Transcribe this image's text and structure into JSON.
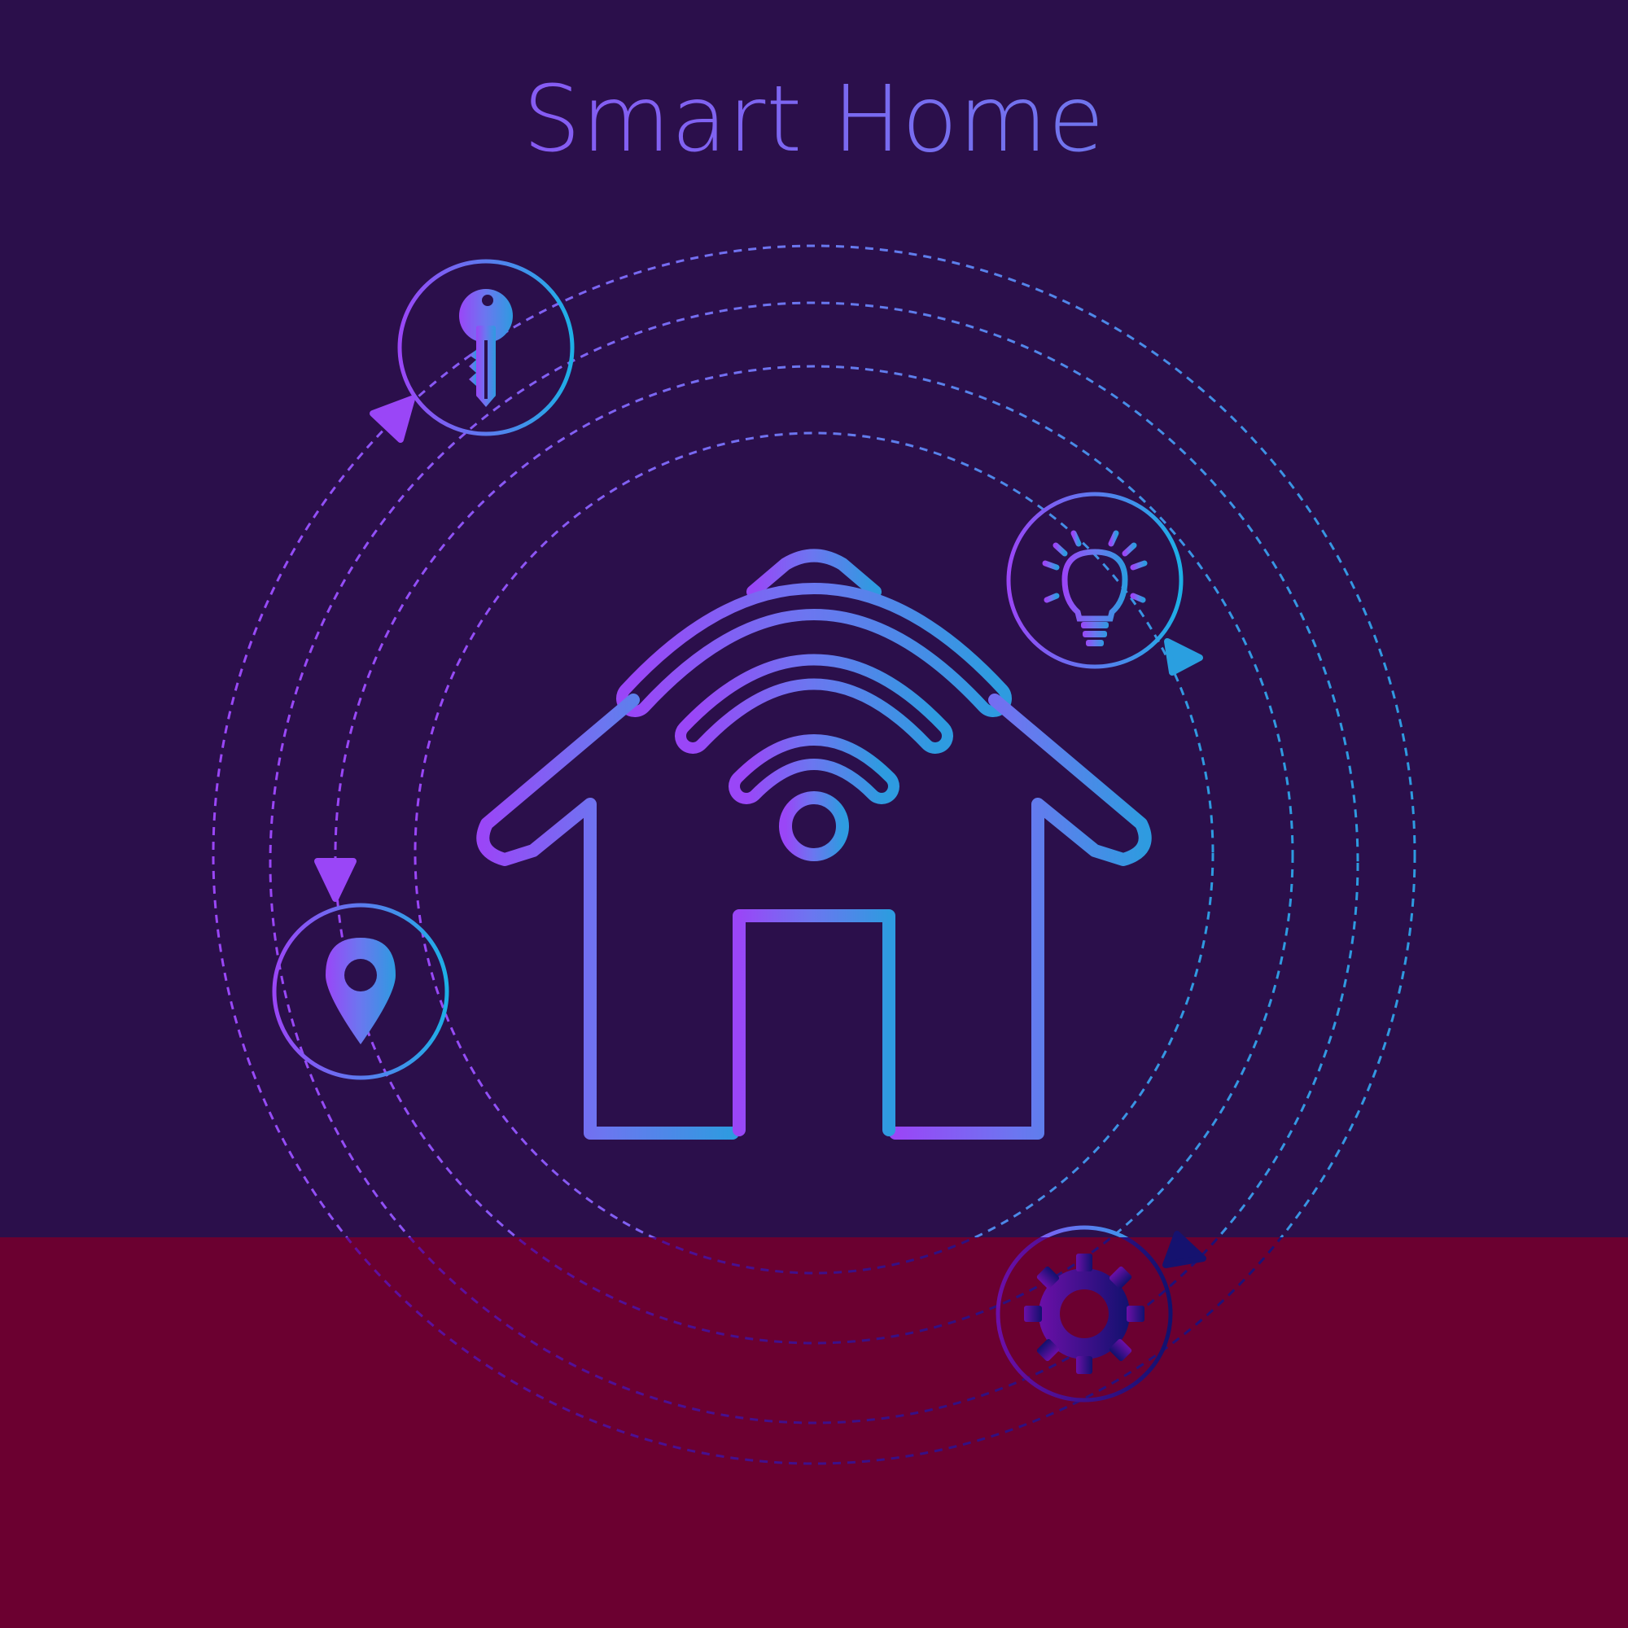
{
  "title": "Smart Home",
  "colors": {
    "background": "#2b0f4b",
    "bottom_band": "#6b0030",
    "gradient_start": "#9a46f7",
    "gradient_mid": "#6c76f0",
    "gradient_end": "#2e9be0",
    "dark_icon_start": "#6c0fa8",
    "dark_icon_end": "#11116e"
  },
  "icons": {
    "center": "wifi-house-icon",
    "top_left": "key-icon",
    "left": "location-pin-icon",
    "right": "lightbulb-icon",
    "bottom": "gear-icon"
  }
}
